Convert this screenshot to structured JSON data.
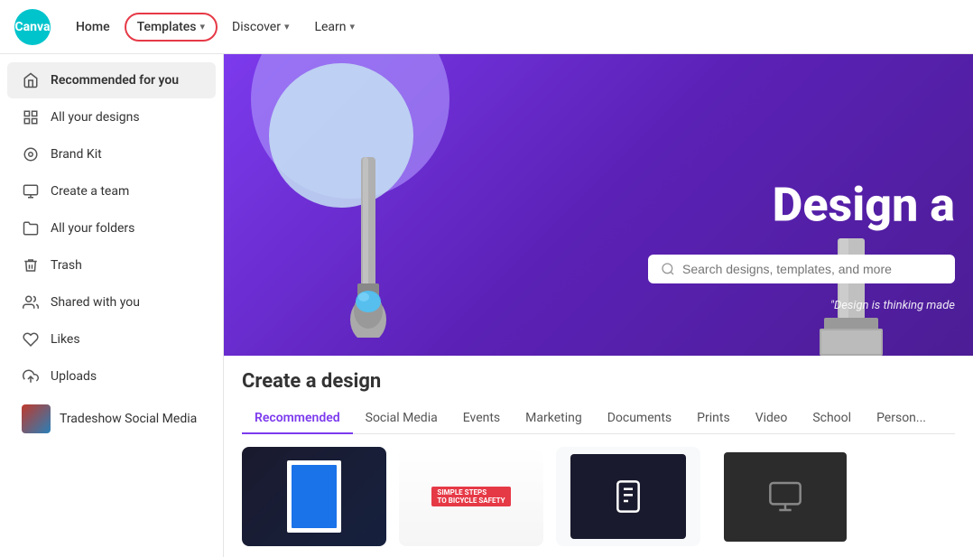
{
  "header": {
    "logo_text": "Canva",
    "nav": [
      {
        "id": "home",
        "label": "Home",
        "has_chevron": false
      },
      {
        "id": "templates",
        "label": "Templates",
        "has_chevron": true,
        "highlighted": true
      },
      {
        "id": "discover",
        "label": "Discover",
        "has_chevron": true
      },
      {
        "id": "learn",
        "label": "Learn",
        "has_chevron": true
      }
    ]
  },
  "sidebar": {
    "items": [
      {
        "id": "recommended",
        "label": "Recommended for you",
        "icon": "home",
        "active": true
      },
      {
        "id": "all-designs",
        "label": "All your designs",
        "icon": "grid"
      },
      {
        "id": "brand-kit",
        "label": "Brand Kit",
        "icon": "brand"
      },
      {
        "id": "create-team",
        "label": "Create a team",
        "icon": "team"
      },
      {
        "id": "all-folders",
        "label": "All your folders",
        "icon": "folder"
      },
      {
        "id": "trash",
        "label": "Trash",
        "icon": "trash"
      },
      {
        "id": "shared",
        "label": "Shared with you",
        "icon": "shared"
      },
      {
        "id": "likes",
        "label": "Likes",
        "icon": "heart"
      },
      {
        "id": "uploads",
        "label": "Uploads",
        "icon": "upload"
      },
      {
        "id": "tradeshow",
        "label": "Tradeshow Social Media",
        "icon": "thumbnail"
      }
    ]
  },
  "hero": {
    "title": "Design a",
    "search_placeholder": "Search designs, templates, and more",
    "quote": "\"Design is thinking made"
  },
  "design_section": {
    "title": "Create a design",
    "tabs": [
      {
        "id": "recommended",
        "label": "Recommended",
        "active": true
      },
      {
        "id": "social-media",
        "label": "Social Media"
      },
      {
        "id": "events",
        "label": "Events"
      },
      {
        "id": "marketing",
        "label": "Marketing"
      },
      {
        "id": "documents",
        "label": "Documents"
      },
      {
        "id": "prints",
        "label": "Prints"
      },
      {
        "id": "video",
        "label": "Video"
      },
      {
        "id": "school",
        "label": "School"
      },
      {
        "id": "personal",
        "label": "Person..."
      }
    ]
  },
  "colors": {
    "accent": "#7c3aed",
    "highlight_border": "#e63946",
    "hero_bg": "#6b2fa0",
    "canva_teal": "#00c4cc"
  }
}
